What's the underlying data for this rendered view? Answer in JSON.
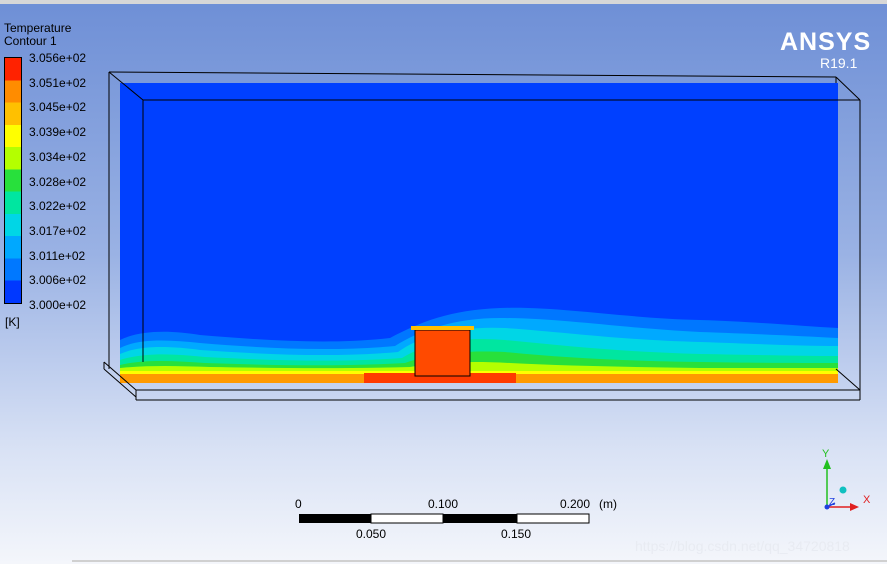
{
  "legend": {
    "title": "Temperature",
    "subtitle": "Contour 1",
    "levels": [
      "3.056e+02",
      "3.051e+02",
      "3.045e+02",
      "3.039e+02",
      "3.034e+02",
      "3.028e+02",
      "3.022e+02",
      "3.017e+02",
      "3.011e+02",
      "3.006e+02",
      "3.000e+02"
    ],
    "unit": "[K]",
    "colors": [
      "#ff2200",
      "#ff8c00",
      "#ffc000",
      "#ffff00",
      "#b4ff00",
      "#28e03c",
      "#00e6a0",
      "#00d6e6",
      "#00a8ff",
      "#0078ff",
      "#0038ff"
    ]
  },
  "branding": {
    "logo": "ANSYS",
    "version": "R19.1"
  },
  "scale": {
    "top_labels": [
      "0",
      "0.100",
      "0.200"
    ],
    "unit": "(m)",
    "bottom_labels": [
      "0.050",
      "0.150"
    ]
  },
  "axes": {
    "y": "Y",
    "z": "Z",
    "x": "X"
  },
  "watermark": "https://blog.csdn.net/qq_34720818"
}
